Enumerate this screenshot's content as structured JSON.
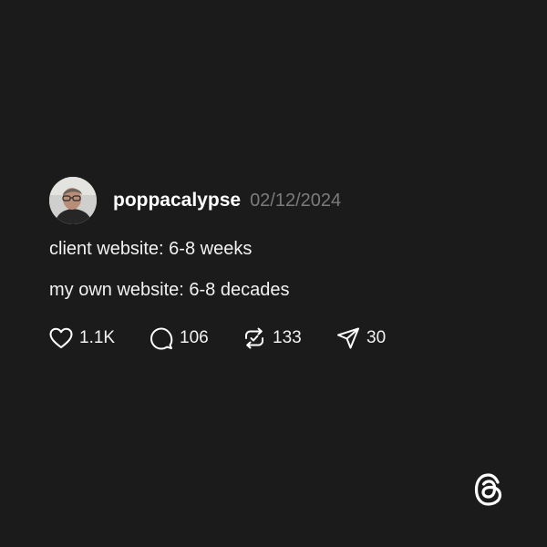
{
  "post": {
    "username": "poppacalypse",
    "date": "02/12/2024",
    "lines": [
      "client website: 6-8 weeks",
      "my own website: 6-8 decades"
    ],
    "actions": {
      "likes": "1.1K",
      "replies": "106",
      "reposts": "133",
      "shares": "30"
    }
  },
  "icons": {
    "like": "heart-icon",
    "reply": "speech-bubble-icon",
    "repost": "repost-icon",
    "share": "send-icon",
    "brand": "threads-logo-icon"
  },
  "colors": {
    "background": "#1b1b1b",
    "text": "#ffffff",
    "muted": "#7b7b7b"
  }
}
